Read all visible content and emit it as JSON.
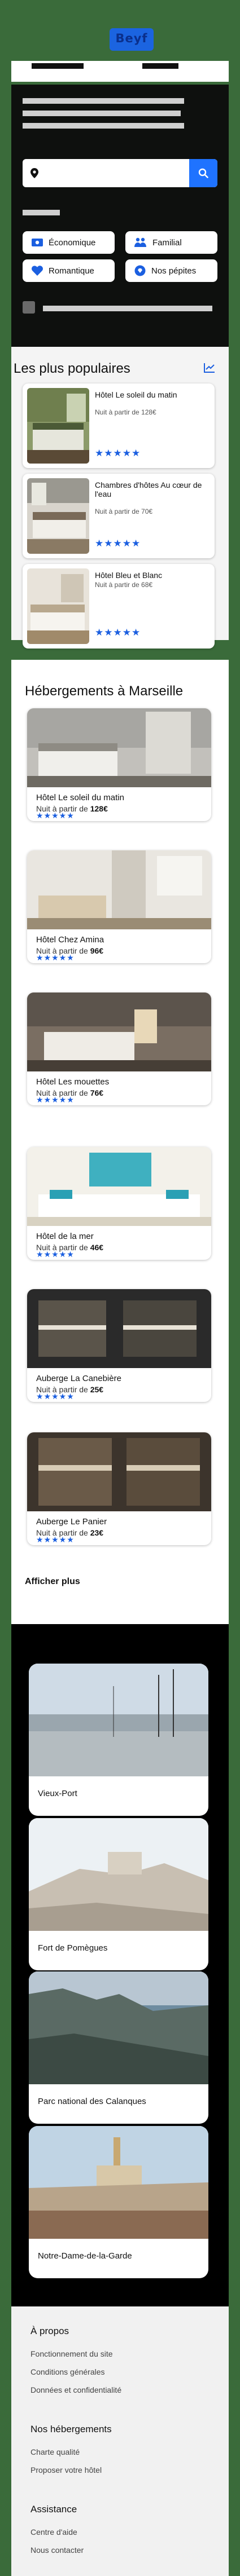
{
  "brand": {
    "logo": "Beyf",
    "accent": "#1f73ff"
  },
  "search": {
    "placeholder": "",
    "value": ""
  },
  "chips": [
    {
      "label": "Économique",
      "icon": "money-icon"
    },
    {
      "label": "Familial",
      "icon": "family-icon"
    },
    {
      "label": "Romantique",
      "icon": "heart-icon"
    },
    {
      "label": "Nos pépites",
      "icon": "gem-icon"
    }
  ],
  "popular": {
    "title": "Les plus populaires",
    "items": [
      {
        "name": "Hôtel Le soleil du matin",
        "price": "Nuit à partir de 128€",
        "rating": 5
      },
      {
        "name": "Chambres d'hôtes Au cœur de l'eau",
        "price": "Nuit à partir de 70€",
        "rating": 5
      },
      {
        "name": "Hôtel Bleu et Blanc",
        "price": "Nuit à partir de 68€",
        "rating": 5
      }
    ]
  },
  "accommodations": {
    "title": "Hébergements à Marseille",
    "items": [
      {
        "name": "Hôtel Le soleil du matin",
        "price_prefix": "Nuit à partir de ",
        "price": "128€",
        "rating": 5
      },
      {
        "name": "Hôtel Chez Amina",
        "price_prefix": "Nuit à partir de ",
        "price": "96€",
        "rating": 5
      },
      {
        "name": "Hôtel Les mouettes",
        "price_prefix": "Nuit à partir de ",
        "price": "76€",
        "rating": 5
      },
      {
        "name": "Hôtel de la mer",
        "price_prefix": "Nuit à partir de ",
        "price": "46€",
        "rating": 5
      },
      {
        "name": "Auberge La Canebière",
        "price_prefix": "Nuit à partir de ",
        "price": "25€",
        "rating": 5
      },
      {
        "name": "Auberge Le Panier",
        "price_prefix": "Nuit à partir de ",
        "price": "23€",
        "rating": 5
      }
    ],
    "more_label": "Afficher plus"
  },
  "places": [
    {
      "name": "Vieux-Port"
    },
    {
      "name": "Fort de Pomègues"
    },
    {
      "name": "Parc national des Calanques"
    },
    {
      "name": "Notre-Dame-de-la-Garde"
    }
  ],
  "footer": {
    "sections": [
      {
        "title": "À propos",
        "links": [
          "Fonctionnement du site",
          "Conditions générales",
          "Données et confidentialité"
        ]
      },
      {
        "title": "Nos hébergements",
        "links": [
          "Charte qualité",
          "Proposer votre hôtel"
        ]
      },
      {
        "title": "Assistance",
        "links": [
          "Centre d'aide",
          "Nous contacter"
        ]
      }
    ]
  }
}
